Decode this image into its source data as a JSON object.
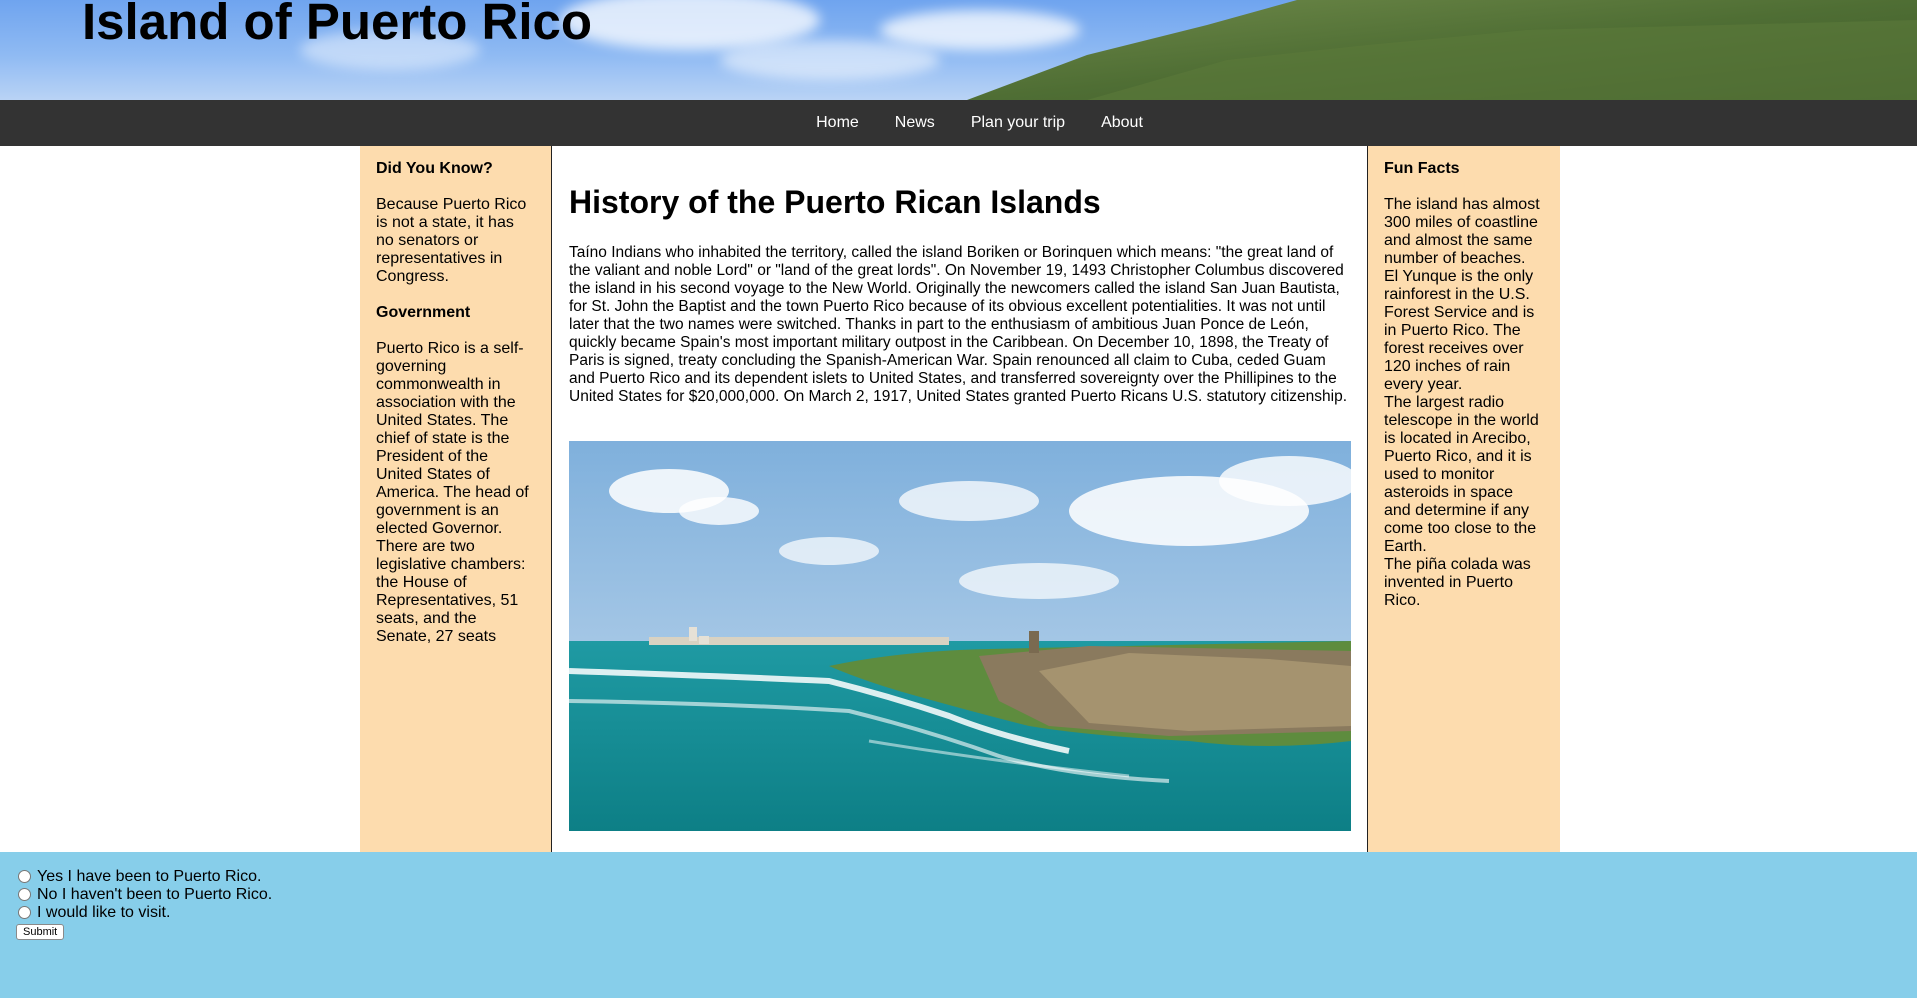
{
  "header": {
    "title": "Island of Puerto Rico"
  },
  "nav": {
    "items": [
      "Home",
      "News",
      "Plan your trip",
      "About"
    ]
  },
  "left_sidebar": {
    "heading1": "Did You Know?",
    "text1": "Because Puerto Rico is not a state, it has no senators or representatives in Congress.",
    "heading2": "Government",
    "text2": "Puerto Rico is a self-governing commonwealth in association with the United States. The chief of state is the President of the United States of America. The head of government is an elected Governor. There are two legislative chambers: the House of Representatives, 51 seats, and the Senate, 27 seats"
  },
  "main": {
    "title": "History of the Puerto Rican Islands",
    "body": "Taíno Indians who inhabited the territory, called the island Boriken or Borinquen which means: \"the great land of the valiant and noble Lord\" or \"land of the great lords\". On November 19, 1493 Christopher Columbus discovered the island in his second voyage to the New World. Originally the newcomers called the island San Juan Bautista, for St. John the Baptist and the town Puerto Rico because of its obvious excellent potentialities. It was not until later that the two names were switched. Thanks in part to the enthusiasm of ambitious Juan Ponce de León, quickly became Spain's most important military outpost in the Caribbean. On December 10, 1898, the Treaty of Paris is signed, treaty concluding the Spanish-American War. Spain renounced all claim to Cuba, ceded Guam and Puerto Rico and its dependent islets to United States, and transferred sovereignty over the Phillipines to the United States for $20,000,000. On March 2, 1917, United States granted Puerto Ricans U.S. statutory citizenship."
  },
  "right_sidebar": {
    "heading": "Fun Facts",
    "facts": [
      "The island has almost 300 miles of coastline and almost the same number of beaches.",
      "El Yunque is the only rainforest in the U.S. Forest Service and is in Puerto Rico. The forest receives over 120 inches of rain every year.",
      "The largest radio telescope in the world is located in Arecibo, Puerto Rico, and it is used to monitor asteroids in space and determine if any come too close to the Earth.",
      "The piña colada was invented in Puerto Rico."
    ]
  },
  "survey": {
    "options": [
      "Yes I have been to Puerto Rico.",
      "No I haven't been to Puerto Rico.",
      "I would like to visit."
    ],
    "submit_label": "Submit"
  },
  "colors": {
    "nav_bg": "#333333",
    "sidebar_bg": "#fddcae",
    "footer_bg": "#87ceea"
  }
}
